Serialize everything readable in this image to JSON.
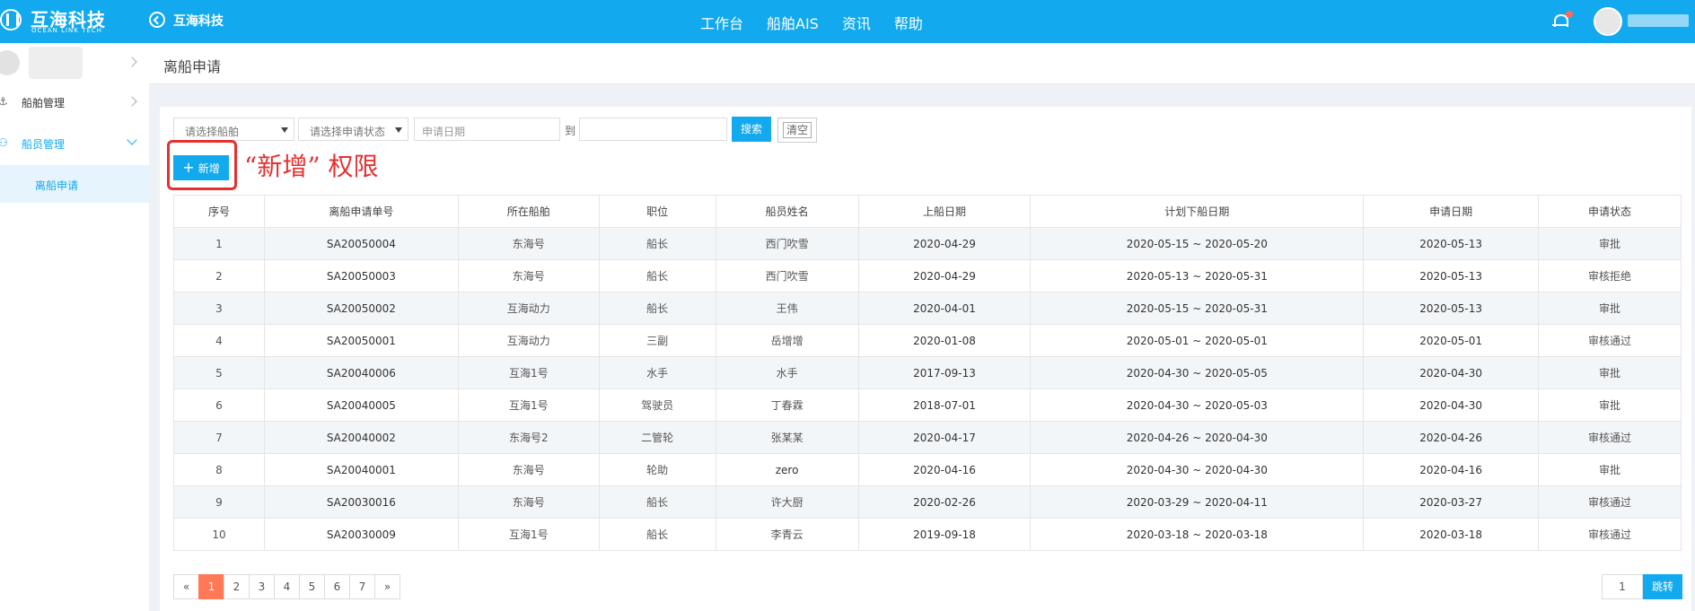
{
  "header": {
    "logo_cn": "互海科技",
    "logo_en": "OCEAN LINK TECH",
    "back_label": "互海科技",
    "nav": [
      "工作台",
      "船舶AIS",
      "资讯",
      "帮助"
    ],
    "icons": [
      "logo-icon",
      "back-arrow-icon",
      "bell-icon",
      "avatar"
    ],
    "accent_color": "#12a9ee"
  },
  "sidebar": {
    "items": [
      {
        "label": "船舶管理",
        "icon": "anchor-icon"
      },
      {
        "label": "船员管理",
        "icon": "user-icon"
      }
    ],
    "sub_item": "离船申请"
  },
  "page": {
    "title": "离船申请"
  },
  "filters": {
    "ship_placeholder": "请选择船舶",
    "status_placeholder": "请选择申请状态",
    "date_placeholder": "申请日期",
    "to_label": "到",
    "search_label": "搜索",
    "clear_label": "清空"
  },
  "toolbar": {
    "add_label": "新增",
    "annotation": "“新增” 权限",
    "annotation_color": "#e53030"
  },
  "table": {
    "columns": [
      "序号",
      "离船申请单号",
      "所在船舶",
      "职位",
      "船员姓名",
      "上船日期",
      "计划下船日期",
      "申请日期",
      "申请状态"
    ],
    "rows": [
      [
        "1",
        "SA20050004",
        "东海号",
        "船长",
        "西门吹雪",
        "2020-04-29",
        "2020-05-15 ~ 2020-05-20",
        "2020-05-13",
        "审批"
      ],
      [
        "2",
        "SA20050003",
        "东海号",
        "船长",
        "西门吹雪",
        "2020-04-29",
        "2020-05-13 ~ 2020-05-31",
        "2020-05-13",
        "审核拒绝"
      ],
      [
        "3",
        "SA20050002",
        "互海动力",
        "船长",
        "王伟",
        "2020-04-01",
        "2020-05-15 ~ 2020-05-31",
        "2020-05-13",
        "审批"
      ],
      [
        "4",
        "SA20050001",
        "互海动力",
        "三副",
        "岳增增",
        "2020-01-08",
        "2020-05-01 ~ 2020-05-01",
        "2020-05-01",
        "审核通过"
      ],
      [
        "5",
        "SA20040006",
        "互海1号",
        "水手",
        "水手",
        "2017-09-13",
        "2020-04-30 ~ 2020-05-05",
        "2020-04-30",
        "审批"
      ],
      [
        "6",
        "SA20040005",
        "互海1号",
        "驾驶员",
        "丁春霖",
        "2018-07-01",
        "2020-04-30 ~ 2020-05-03",
        "2020-04-30",
        "审批"
      ],
      [
        "7",
        "SA20040002",
        "东海号2",
        "二管轮",
        "张某某",
        "2020-04-17",
        "2020-04-26 ~ 2020-04-30",
        "2020-04-26",
        "审核通过"
      ],
      [
        "8",
        "SA20040001",
        "东海号",
        "轮助",
        "zero",
        "2020-04-16",
        "2020-04-30 ~ 2020-04-30",
        "2020-04-16",
        "审批"
      ],
      [
        "9",
        "SA20030016",
        "东海号",
        "船长",
        "许大厨",
        "2020-02-26",
        "2020-03-29 ~ 2020-04-11",
        "2020-03-27",
        "审核通过"
      ],
      [
        "10",
        "SA20030009",
        "互海1号",
        "船长",
        "李青云",
        "2019-09-18",
        "2020-03-18 ~ 2020-03-18",
        "2020-03-18",
        "审核通过"
      ]
    ]
  },
  "pagination": {
    "prev": "«",
    "pages": [
      "1",
      "2",
      "3",
      "4",
      "5",
      "6",
      "7"
    ],
    "next": "»",
    "current": "1",
    "goto_value": "1",
    "goto_label": "跳转"
  }
}
